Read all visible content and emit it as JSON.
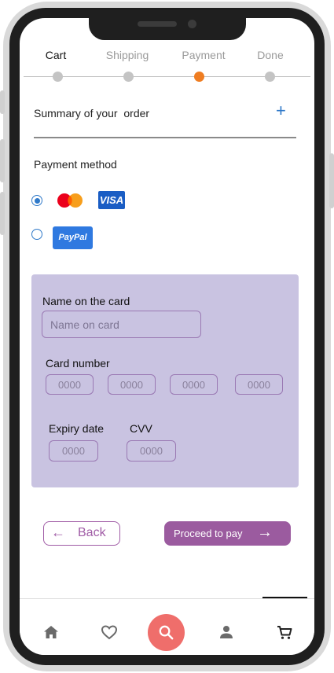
{
  "steps": [
    {
      "label": "Cart",
      "state": "done"
    },
    {
      "label": "Shipping",
      "state": "done"
    },
    {
      "label": "Payment",
      "state": "current"
    },
    {
      "label": "Done",
      "state": "pending"
    }
  ],
  "summary": {
    "label": "Summary of your  order",
    "expand_icon": "plus-icon"
  },
  "payment": {
    "label": "Payment method",
    "options": [
      {
        "name": "card",
        "logos": [
          "mastercard-logo",
          "visa-logo"
        ],
        "selected": true,
        "visa_text": "VISA"
      },
      {
        "name": "paypal",
        "logos": [
          "paypal-logo"
        ],
        "selected": false,
        "paypal_text": "PayPal"
      }
    ]
  },
  "card_form": {
    "name_label": "Name on the card",
    "name_placeholder": "Name on card",
    "number_label": "Card number",
    "number_placeholders": [
      "0000",
      "0000",
      "0000",
      "0000"
    ],
    "expiry_label": "Expiry date",
    "expiry_placeholder": "0000",
    "cvv_label": "CVV",
    "cvv_placeholder": "0000"
  },
  "actions": {
    "back_label": "Back",
    "proceed_label": "Proceed to pay"
  },
  "tabbar": {
    "items": [
      "home-icon",
      "heart-icon",
      "search-icon",
      "user-icon",
      "cart-icon"
    ],
    "active": "cart-icon"
  },
  "colors": {
    "accent_orange": "#ef7d22",
    "accent_blue": "#2f79c9",
    "panel": "#c9c3e1",
    "purple": "#9b5b9f",
    "search_fab": "#ef6e6b"
  }
}
